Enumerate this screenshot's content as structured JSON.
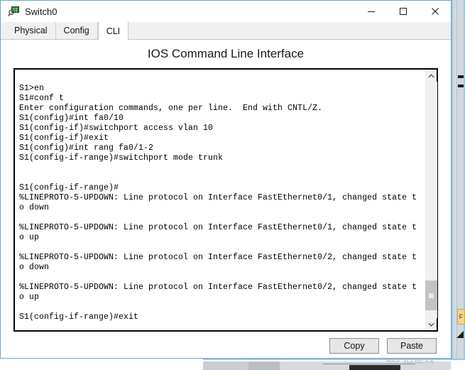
{
  "window": {
    "title": "Switch0",
    "icon": "switch-device-icon",
    "controls": {
      "minimize": "minimize-icon",
      "maximize": "maximize-icon",
      "close": "close-icon"
    }
  },
  "tabs": [
    {
      "label": "Physical",
      "active": false
    },
    {
      "label": "Config",
      "active": false
    },
    {
      "label": "CLI",
      "active": true
    }
  ],
  "panel": {
    "heading": "IOS Command Line Interface"
  },
  "terminal": {
    "lines": [
      "",
      "S1>en",
      "S1#conf t",
      "Enter configuration commands, one per line.  End with CNTL/Z.",
      "S1(config)#int fa0/10",
      "S1(config-if)#switchport access vlan 10",
      "S1(config-if)#exit",
      "S1(config)#int rang fa0/1-2",
      "S1(config-if-range)#switchport mode trunk",
      "",
      "",
      "S1(config-if-range)#",
      "%LINEPROTO-5-UPDOWN: Line protocol on Interface FastEthernet0/1, changed state t",
      "o down",
      "",
      "%LINEPROTO-5-UPDOWN: Line protocol on Interface FastEthernet0/1, changed state t",
      "o up",
      "",
      "%LINEPROTO-5-UPDOWN: Line protocol on Interface FastEthernet0/2, changed state t",
      "o down",
      "",
      "%LINEPROTO-5-UPDOWN: Line protocol on Interface FastEthernet0/2, changed state t",
      "o up",
      "",
      "S1(config-if-range)#exit"
    ]
  },
  "scrollbar": {
    "up_arrow": "chevron-up-icon",
    "down_arrow": "chevron-down-icon"
  },
  "buttons": {
    "copy": "Copy",
    "paste": "Paste"
  },
  "watermark": {
    "text": "亿速云",
    "logo": "cloud-icon"
  },
  "colors": {
    "window_border": "#6aa6cf",
    "tabstrip_bg": "#f0f0f0",
    "terminal_border": "#000000",
    "terminal_text": "#000000",
    "button_bg": "#e6e6e6",
    "scroll_thumb": "#c3c3c3",
    "watermark": "#b7bcc1"
  }
}
